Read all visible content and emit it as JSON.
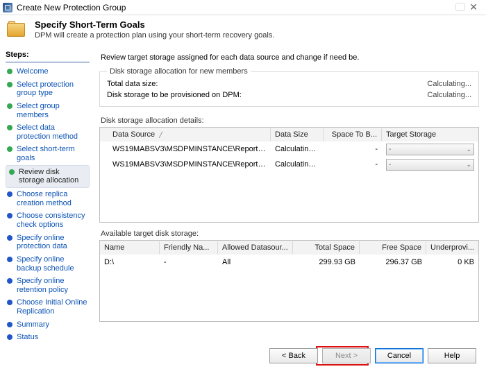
{
  "title": "Create New Protection Group",
  "header": {
    "heading": "Specify Short-Term Goals",
    "subtext": "DPM will create a protection plan using your short-term recovery goals."
  },
  "stepsTitle": "Steps:",
  "steps": [
    {
      "label": "Welcome",
      "state": "done"
    },
    {
      "label": "Select protection group type",
      "state": "done"
    },
    {
      "label": "Select group members",
      "state": "done"
    },
    {
      "label": "Select data protection method",
      "state": "done"
    },
    {
      "label": "Select short-term goals",
      "state": "done"
    },
    {
      "label": "Review disk storage allocation",
      "state": "current"
    },
    {
      "label": "Choose replica creation method",
      "state": "todo"
    },
    {
      "label": "Choose consistency check options",
      "state": "todo"
    },
    {
      "label": "Specify online protection data",
      "state": "todo"
    },
    {
      "label": "Specify online backup schedule",
      "state": "todo"
    },
    {
      "label": "Specify online retention policy",
      "state": "todo"
    },
    {
      "label": "Choose Initial Online Replication",
      "state": "todo"
    },
    {
      "label": "Summary",
      "state": "todo"
    },
    {
      "label": "Status",
      "state": "todo"
    }
  ],
  "intro": "Review target storage assigned for each data source and change if need be.",
  "allocBox": {
    "legend": "Disk storage allocation for new members",
    "totalLabel": "Total data size:",
    "totalValue": "Calculating...",
    "provLabel": "Disk storage to be provisioned on DPM:",
    "provValue": "Calculating..."
  },
  "detailsLabel": "Disk storage allocation details:",
  "detailsCols": {
    "ds": "Data Source",
    "sz": "Data Size",
    "sp": "Space To B...",
    "tg": "Target Storage"
  },
  "detailsRows": [
    {
      "ds": "WS19MABSV3\\MSDPMINSTANCE\\ReportServe...",
      "sz": "Calculating ...",
      "sp": "-",
      "tg": "-"
    },
    {
      "ds": "WS19MABSV3\\MSDPMINSTANCE\\ReportServe...",
      "sz": "Calculating ...",
      "sp": "-",
      "tg": "-"
    }
  ],
  "storeLabel": "Available target disk storage:",
  "storeCols": {
    "nm": "Name",
    "fn": "Friendly Na...",
    "ad": "Allowed Datasour...",
    "ts": "Total Space",
    "fs": "Free Space",
    "up": "Underprovi..."
  },
  "storeRows": [
    {
      "nm": "D:\\",
      "fn": "-",
      "ad": "All",
      "ts": "299.93 GB",
      "fs": "296.37 GB",
      "up": "0 KB"
    }
  ],
  "buttons": {
    "back": "< Back",
    "next": "Next >",
    "cancel": "Cancel",
    "help": "Help"
  }
}
